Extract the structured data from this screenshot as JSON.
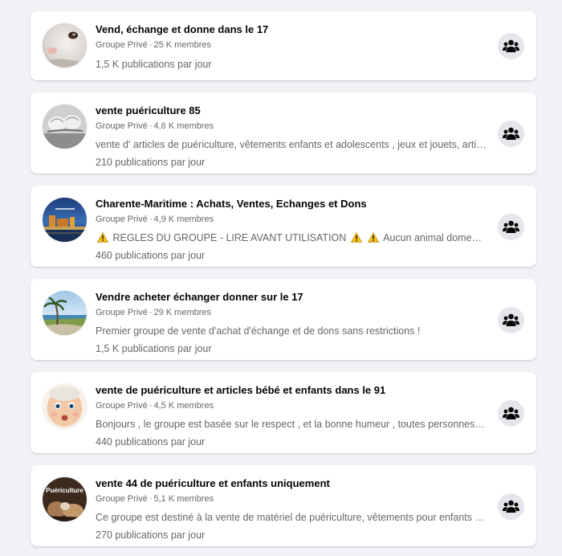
{
  "colors": {
    "page_background": "#f0f2f5",
    "card_background": "#ffffff",
    "primary_text": "#050505",
    "secondary_text": "#65676b",
    "join_button_background": "#e4e6eb",
    "warning_yellow": "#f7c21a"
  },
  "groups": [
    {
      "title": "Vend, échange et donne dans le 17",
      "privacy": "Groupe Privé",
      "separator": "·",
      "members": "25 K membres",
      "description": "",
      "activity": "1,5 K publications par jour",
      "avatar_icon": "white-cat-photo",
      "join_icon": "groups-icon"
    },
    {
      "title": "vente puériculture 85",
      "privacy": "Groupe Privé",
      "separator": "·",
      "members": "4,6 K membres",
      "description": "vente d' articles de puériculture, vêtements enfants et adolescents , jeux et jouets, articles de maison",
      "activity": "210 publications par jour",
      "avatar_icon": "baby-shoes-photo",
      "join_icon": "groups-icon"
    },
    {
      "title": "Charente-Maritime : Achats, Ventes, Echanges et Dons",
      "privacy": "Groupe Privé",
      "separator": "·",
      "members": "4,9 K membres",
      "description_parts": [
        "REGLES DU GROUPE - LIRE AVANT UTILISATION",
        "Aucun animal domestique ne sera accepté"
      ],
      "warning_icon": "warning-sign-icon",
      "activity": "460 publications par jour",
      "avatar_icon": "harbor-night-photo",
      "join_icon": "groups-icon"
    },
    {
      "title": "Vendre acheter échanger donner sur le 17",
      "privacy": "Groupe Privé",
      "separator": "·",
      "members": "29 K membres",
      "description": "Premier groupe de vente d'achat d'échange et de dons sans restrictions !",
      "activity": "1,5 K publications par jour",
      "avatar_icon": "palm-beach-photo",
      "join_icon": "groups-icon"
    },
    {
      "title": "vente de puériculture et articles bébé et enfants dans le 91",
      "privacy": "Groupe Privé",
      "separator": "·",
      "members": "4,5 K membres",
      "description": "Bonjours , le groupe est basée sur le respect , et la bonne humeur , toutes personnes irrespectueuses seront supprimées",
      "activity": "440 publications par jour",
      "avatar_icon": "baby-face-photo",
      "join_icon": "groups-icon"
    },
    {
      "title": "vente 44 de puériculture et enfants uniquement",
      "privacy": "Groupe Privé",
      "separator": "·",
      "members": "5,1 K membres",
      "description": "Ce groupe est destiné à la vente de matériel de puériculture, vêtements pour enfants et jouets",
      "activity": "270 publications par jour",
      "avatar_icon": "puericulture-logo",
      "avatar_text": "Puériculture",
      "join_icon": "groups-icon"
    }
  ]
}
